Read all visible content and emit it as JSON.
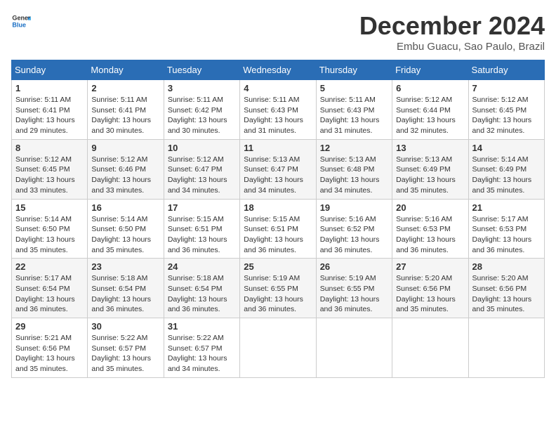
{
  "header": {
    "logo_line1": "General",
    "logo_line2": "Blue",
    "month_title": "December 2024",
    "location": "Embu Guacu, Sao Paulo, Brazil"
  },
  "days_of_week": [
    "Sunday",
    "Monday",
    "Tuesday",
    "Wednesday",
    "Thursday",
    "Friday",
    "Saturday"
  ],
  "weeks": [
    [
      {
        "day": "1",
        "info": "Sunrise: 5:11 AM\nSunset: 6:41 PM\nDaylight: 13 hours\nand 29 minutes."
      },
      {
        "day": "2",
        "info": "Sunrise: 5:11 AM\nSunset: 6:41 PM\nDaylight: 13 hours\nand 30 minutes."
      },
      {
        "day": "3",
        "info": "Sunrise: 5:11 AM\nSunset: 6:42 PM\nDaylight: 13 hours\nand 30 minutes."
      },
      {
        "day": "4",
        "info": "Sunrise: 5:11 AM\nSunset: 6:43 PM\nDaylight: 13 hours\nand 31 minutes."
      },
      {
        "day": "5",
        "info": "Sunrise: 5:11 AM\nSunset: 6:43 PM\nDaylight: 13 hours\nand 31 minutes."
      },
      {
        "day": "6",
        "info": "Sunrise: 5:12 AM\nSunset: 6:44 PM\nDaylight: 13 hours\nand 32 minutes."
      },
      {
        "day": "7",
        "info": "Sunrise: 5:12 AM\nSunset: 6:45 PM\nDaylight: 13 hours\nand 32 minutes."
      }
    ],
    [
      {
        "day": "8",
        "info": "Sunrise: 5:12 AM\nSunset: 6:45 PM\nDaylight: 13 hours\nand 33 minutes."
      },
      {
        "day": "9",
        "info": "Sunrise: 5:12 AM\nSunset: 6:46 PM\nDaylight: 13 hours\nand 33 minutes."
      },
      {
        "day": "10",
        "info": "Sunrise: 5:12 AM\nSunset: 6:47 PM\nDaylight: 13 hours\nand 34 minutes."
      },
      {
        "day": "11",
        "info": "Sunrise: 5:13 AM\nSunset: 6:47 PM\nDaylight: 13 hours\nand 34 minutes."
      },
      {
        "day": "12",
        "info": "Sunrise: 5:13 AM\nSunset: 6:48 PM\nDaylight: 13 hours\nand 34 minutes."
      },
      {
        "day": "13",
        "info": "Sunrise: 5:13 AM\nSunset: 6:49 PM\nDaylight: 13 hours\nand 35 minutes."
      },
      {
        "day": "14",
        "info": "Sunrise: 5:14 AM\nSunset: 6:49 PM\nDaylight: 13 hours\nand 35 minutes."
      }
    ],
    [
      {
        "day": "15",
        "info": "Sunrise: 5:14 AM\nSunset: 6:50 PM\nDaylight: 13 hours\nand 35 minutes."
      },
      {
        "day": "16",
        "info": "Sunrise: 5:14 AM\nSunset: 6:50 PM\nDaylight: 13 hours\nand 35 minutes."
      },
      {
        "day": "17",
        "info": "Sunrise: 5:15 AM\nSunset: 6:51 PM\nDaylight: 13 hours\nand 36 minutes."
      },
      {
        "day": "18",
        "info": "Sunrise: 5:15 AM\nSunset: 6:51 PM\nDaylight: 13 hours\nand 36 minutes."
      },
      {
        "day": "19",
        "info": "Sunrise: 5:16 AM\nSunset: 6:52 PM\nDaylight: 13 hours\nand 36 minutes."
      },
      {
        "day": "20",
        "info": "Sunrise: 5:16 AM\nSunset: 6:53 PM\nDaylight: 13 hours\nand 36 minutes."
      },
      {
        "day": "21",
        "info": "Sunrise: 5:17 AM\nSunset: 6:53 PM\nDaylight: 13 hours\nand 36 minutes."
      }
    ],
    [
      {
        "day": "22",
        "info": "Sunrise: 5:17 AM\nSunset: 6:54 PM\nDaylight: 13 hours\nand 36 minutes."
      },
      {
        "day": "23",
        "info": "Sunrise: 5:18 AM\nSunset: 6:54 PM\nDaylight: 13 hours\nand 36 minutes."
      },
      {
        "day": "24",
        "info": "Sunrise: 5:18 AM\nSunset: 6:54 PM\nDaylight: 13 hours\nand 36 minutes."
      },
      {
        "day": "25",
        "info": "Sunrise: 5:19 AM\nSunset: 6:55 PM\nDaylight: 13 hours\nand 36 minutes."
      },
      {
        "day": "26",
        "info": "Sunrise: 5:19 AM\nSunset: 6:55 PM\nDaylight: 13 hours\nand 36 minutes."
      },
      {
        "day": "27",
        "info": "Sunrise: 5:20 AM\nSunset: 6:56 PM\nDaylight: 13 hours\nand 35 minutes."
      },
      {
        "day": "28",
        "info": "Sunrise: 5:20 AM\nSunset: 6:56 PM\nDaylight: 13 hours\nand 35 minutes."
      }
    ],
    [
      {
        "day": "29",
        "info": "Sunrise: 5:21 AM\nSunset: 6:56 PM\nDaylight: 13 hours\nand 35 minutes."
      },
      {
        "day": "30",
        "info": "Sunrise: 5:22 AM\nSunset: 6:57 PM\nDaylight: 13 hours\nand 35 minutes."
      },
      {
        "day": "31",
        "info": "Sunrise: 5:22 AM\nSunset: 6:57 PM\nDaylight: 13 hours\nand 34 minutes."
      },
      {
        "day": "",
        "info": ""
      },
      {
        "day": "",
        "info": ""
      },
      {
        "day": "",
        "info": ""
      },
      {
        "day": "",
        "info": ""
      }
    ]
  ]
}
